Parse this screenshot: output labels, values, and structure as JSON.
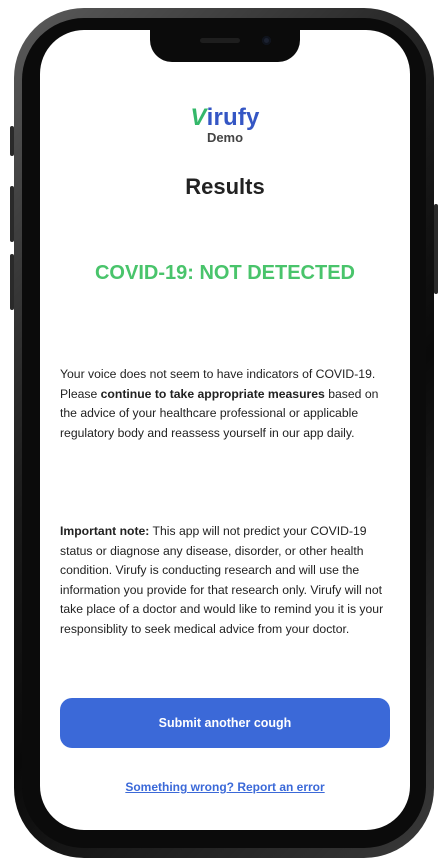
{
  "app": {
    "logo_initial": "V",
    "logo_rest": "irufy",
    "subtitle": "Demo"
  },
  "page": {
    "title": "Results",
    "status": "COVID-19: NOT DETECTED"
  },
  "message": {
    "part1": "Your voice does not seem to have indicators of COVID-19. Please ",
    "emphasis": "continue to take appropriate measures",
    "part2": " based on the advice of your healthcare professional or applicable regulatory body and reassess yourself in our app daily."
  },
  "note": {
    "label": "Important note:",
    "text": " This app will not predict your COVID-19 status or diagnose any disease, disorder, or other health condition. Virufy is conducting research and will use the information you provide for that research only. Virufy will not take place of a doctor and would like to remind you it is your responsiblity to seek medical advice from your doctor."
  },
  "actions": {
    "submit_label": "Submit another cough",
    "report_label": "Something wrong? Report an error"
  },
  "colors": {
    "brand_blue": "#3b69d8",
    "logo_green": "#34b86a",
    "status_green": "#49c46b"
  }
}
